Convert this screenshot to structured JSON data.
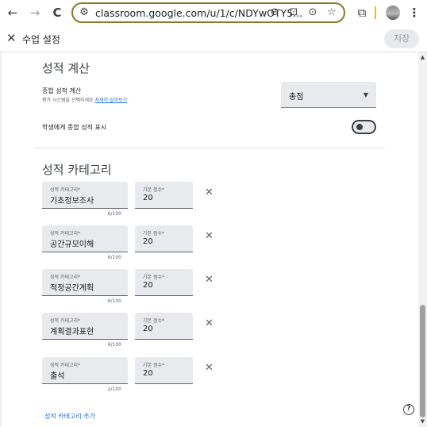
{
  "browser": {
    "url": "classroom.google.com/u/1/c/NDYwOTY5...",
    "back_icon": "←",
    "forward_icon": "→",
    "reload_icon": "C",
    "site_settings_icon": "⚙",
    "zoom_icon": "⊖",
    "install_icon": "⊡",
    "screenshot_icon": "⊙",
    "star_icon": "☆",
    "extensions_icon": "⧉",
    "menu_icon": "⋮"
  },
  "header": {
    "close_icon": "✕",
    "title": "수업 설정",
    "save_label": "저장"
  },
  "grade_calc": {
    "title": "성적 계산",
    "overall_label": "종합 성적 계산",
    "overall_sub": "평가 시스템을 선택하세요",
    "learn_more": "자세히 알아보기",
    "select_value": "총점",
    "select_arrow": "▼",
    "show_label": "학생에게 종합 성적 표시",
    "show_toggle_on": false
  },
  "categories": {
    "title": "성적 카테고리",
    "category_label": "성적 카테고리*",
    "points_label": "기본 점수*",
    "remove_icon": "✕",
    "items": [
      {
        "name": "기초정보조사",
        "points": "20",
        "counter": "6/100"
      },
      {
        "name": "공간규모이해",
        "points": "20",
        "counter": "6/100"
      },
      {
        "name": "적정공간계획",
        "points": "20",
        "counter": "6/100"
      },
      {
        "name": "계획결과표현",
        "points": "20",
        "counter": "6/100"
      },
      {
        "name": "출석",
        "points": "20",
        "counter": "2/100"
      }
    ],
    "add_label": "성적 카테고리 추가"
  },
  "help_icon": "?",
  "scroll_up": "▲",
  "scroll_down": "▼",
  "colors": {
    "accent": "#1a73e8",
    "field_bg": "#e8eaed",
    "url_border": "#8a7a2a"
  }
}
